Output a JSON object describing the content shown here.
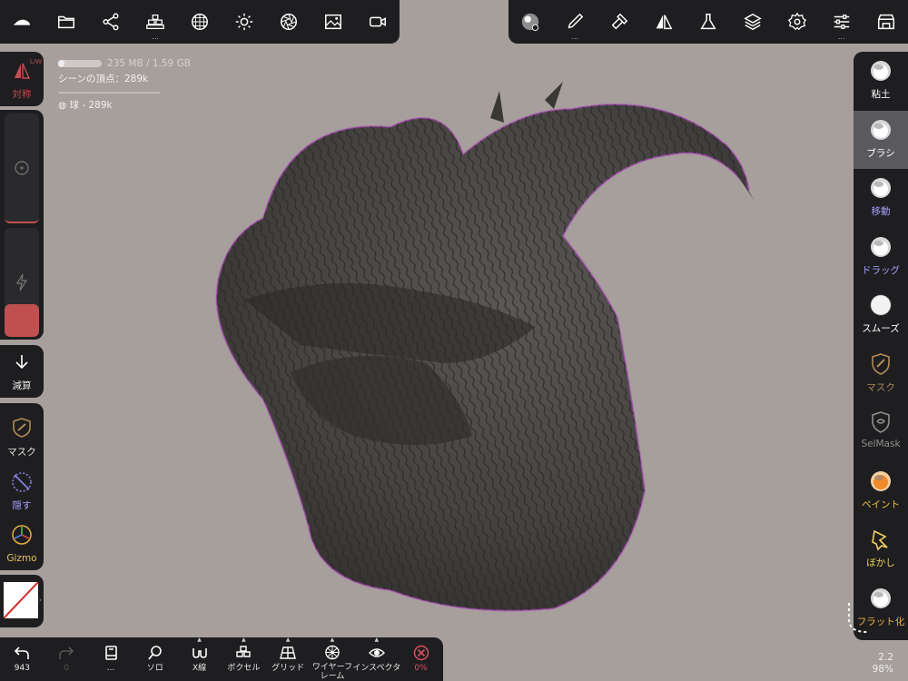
{
  "top_left_toolbar": [
    {
      "name": "hat-icon",
      "has_more": false
    },
    {
      "name": "folder-icon",
      "has_more": false
    },
    {
      "name": "share-nodes-icon",
      "has_more": false
    },
    {
      "name": "stack-icon",
      "has_more": true,
      "more": "..."
    },
    {
      "name": "sphere-grid-icon",
      "has_more": false
    },
    {
      "name": "sun-icon",
      "has_more": false
    },
    {
      "name": "aperture-icon",
      "has_more": false
    },
    {
      "name": "image-icon",
      "has_more": false
    },
    {
      "name": "video-camera-icon",
      "has_more": false
    }
  ],
  "top_right_toolbar": [
    {
      "name": "material-ball-icon",
      "has_more": false
    },
    {
      "name": "brush-pen-icon",
      "has_more": true,
      "more": "..."
    },
    {
      "name": "hammer-icon",
      "has_more": false
    },
    {
      "name": "symmetry-icon",
      "has_more": false
    },
    {
      "name": "flask-icon",
      "has_more": false
    },
    {
      "name": "layers-icon",
      "has_more": false
    },
    {
      "name": "gear-icon",
      "has_more": false
    },
    {
      "name": "sliders-icon",
      "has_more": true,
      "more": "..."
    },
    {
      "name": "shop-icon",
      "has_more": false
    }
  ],
  "left": {
    "symmetry_label": "対称",
    "symmetry_badge": "L/W",
    "subtract_label": "減算",
    "mask_label": "マスク",
    "hide_label": "隠す",
    "gizmo_label": "Gizmo",
    "radius_level": 0.0,
    "intensity_level": 0.15
  },
  "info": {
    "memory": "235 MB / 1.59 GB",
    "memory_fraction": 0.15,
    "vertices": "シーンの頂点：289k",
    "divider": "----------------------------------------",
    "object": "球 - 289k"
  },
  "tools": [
    {
      "label": "粘土",
      "color": "#ffffff",
      "active": false
    },
    {
      "label": "ブラシ",
      "color": "#ffffff",
      "active": true
    },
    {
      "label": "移動",
      "color": "#a7a3ff",
      "active": false
    },
    {
      "label": "ドラッグ",
      "color": "#a7a3ff",
      "active": false
    },
    {
      "label": "スムーズ",
      "color": "#ffffff",
      "active": false
    },
    {
      "label": "マスク",
      "color": "#b08a55",
      "active": false
    },
    {
      "label": "SelMask",
      "color": "#8f8f8f",
      "active": false
    },
    {
      "label": "ペイント",
      "color": "#f0c040",
      "active": false
    },
    {
      "label": "ぼかし",
      "color": "#f0d060",
      "active": false
    },
    {
      "label": "フラット化",
      "color": "#f0b040",
      "active": false
    }
  ],
  "bottom": {
    "undo_count": "943",
    "redo_count": "0",
    "more": "...",
    "solo": "ソロ",
    "xray": "X線",
    "voxel": "ボクセル",
    "grid": "グリッド",
    "wireframe_1": "ワイヤーフ",
    "wireframe_2": "レーム",
    "inspector": "インスペクタ",
    "close_pct": "0%"
  },
  "zoom": {
    "value": "2.2",
    "percent": "98%"
  },
  "colors": {
    "background": "#a69f9c",
    "panel": "#1e1e21",
    "accent_red": "#c05050",
    "sculpt": "#4a4845",
    "rim": "#b040c0"
  }
}
